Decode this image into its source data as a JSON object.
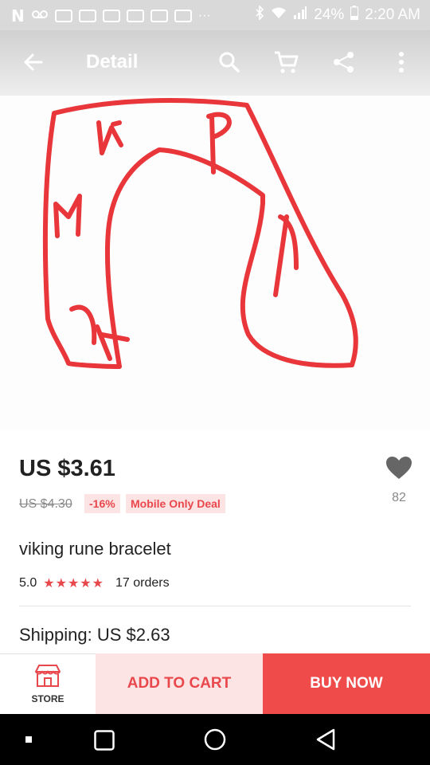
{
  "status_bar": {
    "battery": "24%",
    "time": "2:20 AM",
    "overflow": "···"
  },
  "app_bar": {
    "title": "Detail",
    "icons": [
      "back-arrow-icon",
      "search-icon",
      "cart-icon",
      "share-icon",
      "more-vert-icon"
    ]
  },
  "product": {
    "price": "US $3.61",
    "old_price": "US $4.30",
    "discount": "-16%",
    "deal_label": "Mobile Only Deal",
    "wishlist_count": "82",
    "title": "viking rune bracelet",
    "rating": "5.0",
    "stars": "★★★★★",
    "orders": "17 orders",
    "shipping": "Shipping: US $2.63"
  },
  "bottom_bar": {
    "store_label": "STORE",
    "add_to_cart": "ADD TO CART",
    "buy_now": "BUY NOW"
  },
  "colors": {
    "accent": "#e8474c",
    "buy_now_bg": "#ef4b4b",
    "add_to_cart_bg": "#fde4e4",
    "drawing_stroke": "#e8363a"
  }
}
